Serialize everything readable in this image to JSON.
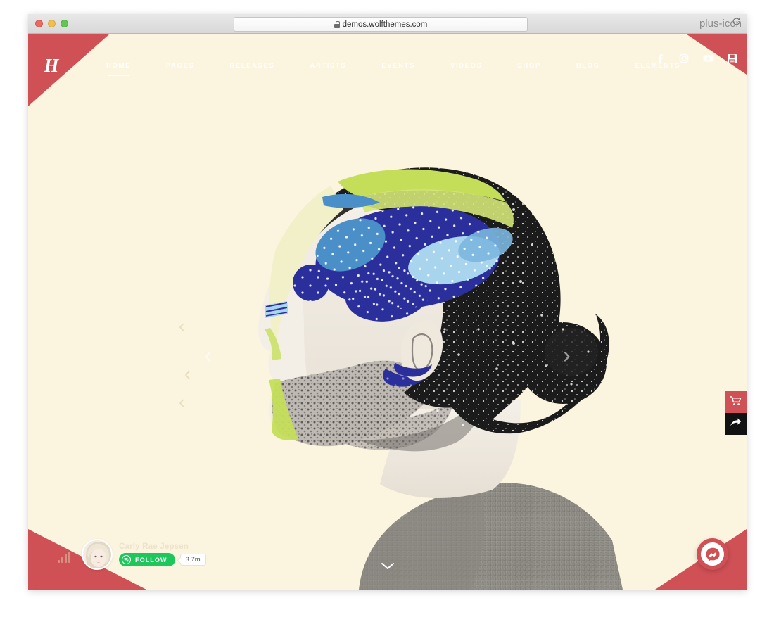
{
  "browser": {
    "url": "demos.wolfthemes.com",
    "lock_icon": "lock-icon",
    "reload_icon": "reload-icon",
    "new_tab_icon": "plus-icon",
    "traffic_lights": [
      "close-red",
      "minimize-yellow",
      "maximize-green"
    ]
  },
  "site": {
    "logo_text": "H",
    "accent_color": "#CF5055",
    "background_color": "#FBF4DF",
    "nav": [
      {
        "label": "HOME",
        "active": true
      },
      {
        "label": "PAGES",
        "active": false
      },
      {
        "label": "RELEASES",
        "active": false
      },
      {
        "label": "ARTISTS",
        "active": false
      },
      {
        "label": "EVENTS",
        "active": false
      },
      {
        "label": "VIDEOS",
        "active": false
      },
      {
        "label": "SHOP",
        "active": false
      },
      {
        "label": "BLOG",
        "active": false
      },
      {
        "label": "ELEMENTS",
        "active": false
      }
    ],
    "social": [
      {
        "name": "facebook-icon"
      },
      {
        "name": "instagram-icon"
      },
      {
        "name": "youtube-icon"
      },
      {
        "name": "save-icon"
      }
    ]
  },
  "hero": {
    "prev_arrow": "‹",
    "next_arrow": "›",
    "scroll_hint_icon": "chevron-down-icon",
    "artwork_title": "collage-portrait-artwork",
    "art_colors": {
      "deep_blue": "#2B2F9C",
      "mid_blue": "#4A8FC8",
      "light_blue": "#A9D4EE",
      "lime": "#C5DE5A",
      "pale_yellow": "#F2F0C8"
    }
  },
  "side_actions": [
    {
      "name": "cart-button",
      "icon": "shopping-cart-icon",
      "color": "#CF5055"
    },
    {
      "name": "share-button",
      "icon": "share-arrow-icon",
      "color": "#111111"
    }
  ],
  "follow_widget": {
    "artist": "Carly Rae Jepsen",
    "follow_label": "FOLLOW",
    "follower_count": "3.7m",
    "brand_color": "#1EC75C",
    "spotify_icon": "spotify-icon",
    "equalizer_icon": "equalizer-icon",
    "avatar_icon": "artist-avatar"
  },
  "messenger": {
    "icon": "messenger-icon",
    "color": "#CF5055"
  }
}
